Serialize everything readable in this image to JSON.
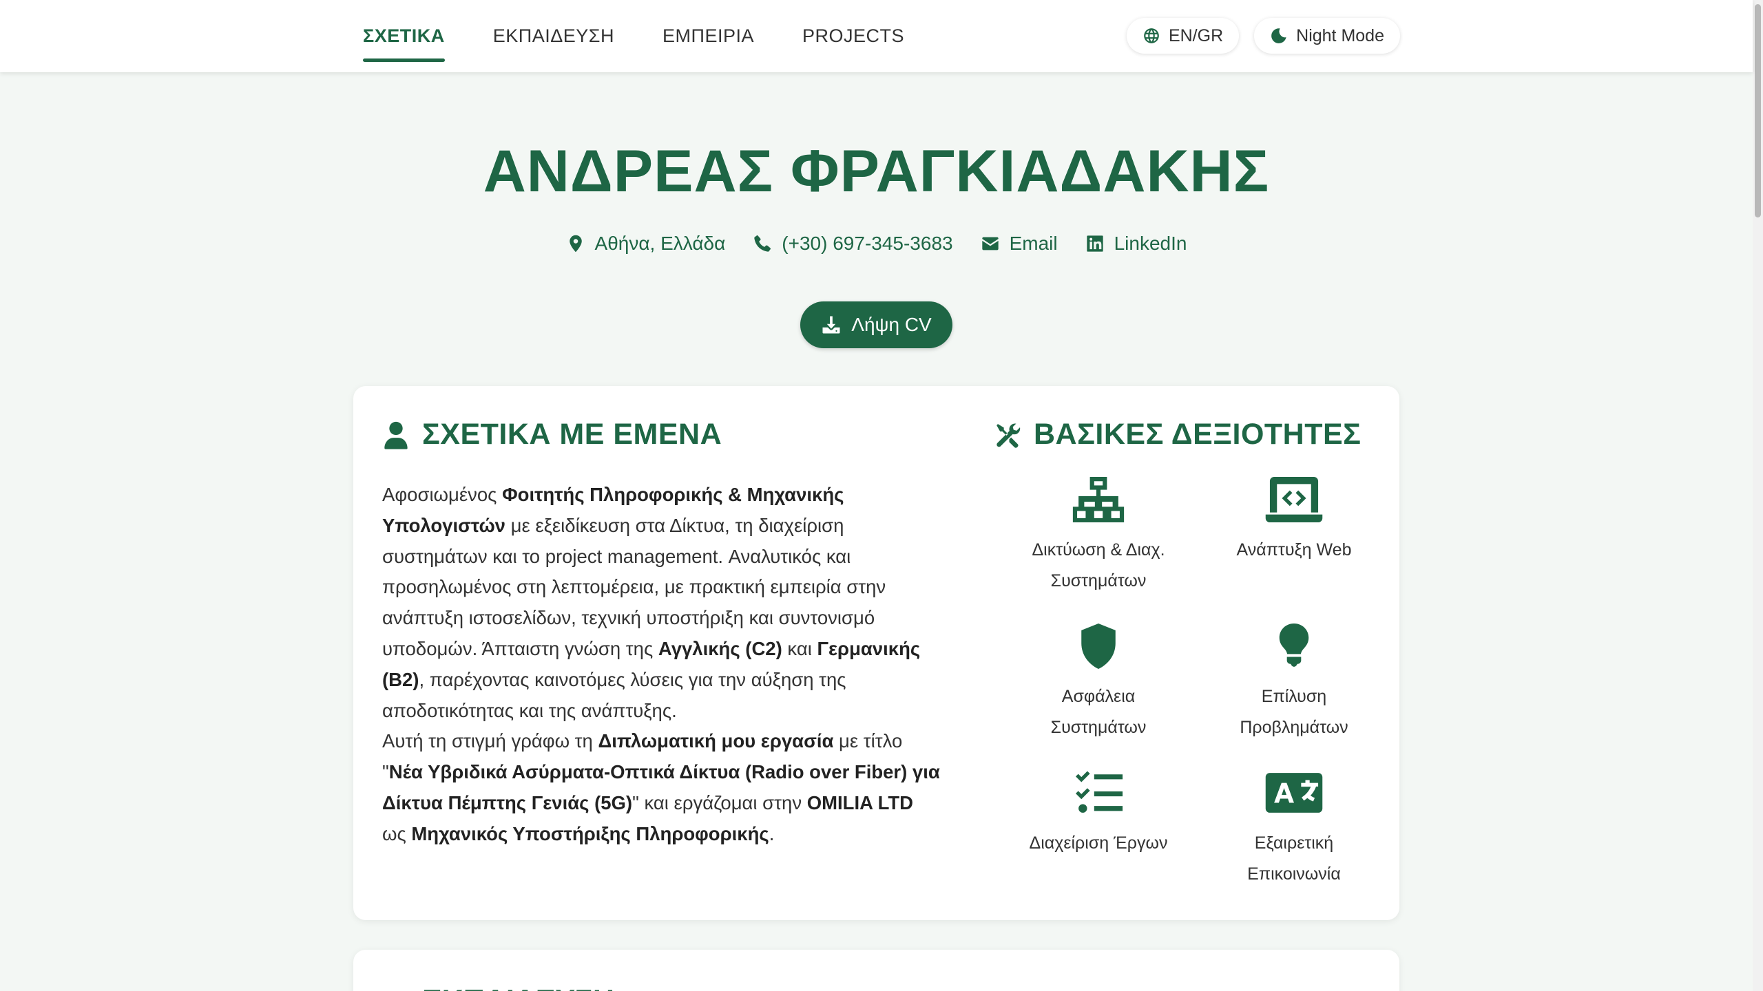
{
  "nav": {
    "links": [
      "ΣΧΕΤΙΚΑ",
      "ΕΚΠΑΙΔΕΥΣΗ",
      "ΕΜΠΕΙΡΙΑ",
      "PROJECTS"
    ],
    "active_index": 0,
    "language_label": "EN/GR",
    "night_mode_label": "Night Mode"
  },
  "hero": {
    "name": "ΑΝΔΡΕΑΣ ΦΡΑΓΚΙΑΔΑΚΗΣ",
    "location": "Αθήνα, Ελλάδα",
    "phone": "(+30) 697-345-3683",
    "email_label": "Email",
    "linkedin_label": "LinkedIn",
    "cv_button": "Λήψη CV"
  },
  "about": {
    "title": "ΣΧΕΤΙΚΑ ΜΕ ΕΜΕΝΑ",
    "p1_a": "Αφοσιωμένος ",
    "p1_b": "Φοιτητής Πληροφορικής & Μηχανικής Υπολογιστών",
    "p1_c": " με εξειδίκευση στα Δίκτυα, τη διαχείριση συστημάτων και το project management. Αναλυτικός και προσηλωμένος στη λεπτομέρεια, με πρακτική εμπειρία στην ανάπτυξη ιστοσελίδων, τεχνική υποστήριξη και συντονισμό υποδομών. Άπταιστη γνώση της ",
    "p1_d": "Αγγλικής (C2)",
    "p1_e": " και ",
    "p1_f": "Γερμανικής (B2)",
    "p1_g": ", παρέχοντας καινοτόμες λύσεις για την αύξηση της αποδοτικότητας και της ανάπτυξης.",
    "p2_a": "Αυτή τη στιγμή γράφω τη ",
    "p2_b": "Διπλωματική μου εργασία",
    "p2_c": " με τίτλο \"",
    "p2_d": "Νέα Υβριδικά Ασύρματα-Οπτικά Δίκτυα (Radio over Fiber) για Δίκτυα Πέμπτης Γενιάς (5G)",
    "p2_e": "\" και εργάζομαι στην ",
    "p2_f": "OMILIA LTD",
    "p2_g": " ως ",
    "p2_h": "Μηχανικός Υποστήριξης Πληροφορικής",
    "p2_i": "."
  },
  "skills": {
    "title": "ΒΑΣΙΚΕΣ ΔΕΞΙΟΤΗΤΕΣ",
    "items": [
      {
        "icon": "network-icon",
        "label": "Δικτύωση & Διαχ.\nΣυστημάτων"
      },
      {
        "icon": "laptop-code-icon",
        "label": "Ανάπτυξη Web"
      },
      {
        "icon": "shield-icon",
        "label": "Ασφάλεια\nΣυστημάτων"
      },
      {
        "icon": "lightbulb-icon",
        "label": "Επίλυση\nΠροβλημάτων"
      },
      {
        "icon": "list-check-icon",
        "label": "Διαχείριση Έργων"
      },
      {
        "icon": "language-icon",
        "label": "Εξαιρετική\nΕπικοινωνία"
      }
    ]
  },
  "education": {
    "title": "ΕΚΠΑΙΔΕΥΣΗ"
  },
  "colors": {
    "accent": "#1e6645",
    "background": "#f3f7f4"
  }
}
